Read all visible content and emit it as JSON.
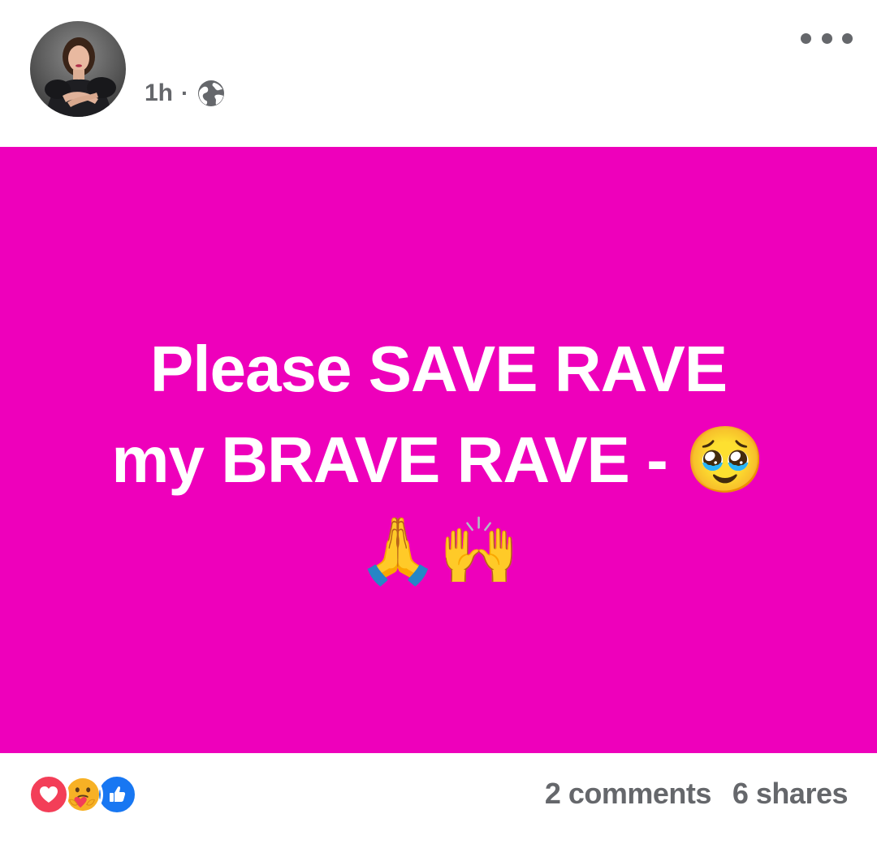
{
  "post": {
    "time": "1h",
    "separator": "·",
    "privacy_icon": "globe-icon",
    "more_icon": "more-options-icon",
    "avatar_icon": "profile-avatar",
    "background_color": "#ee00bb",
    "text_line1": "Please SAVE RAVE",
    "text_line2_prefix": "my BRAVE RAVE - ",
    "text_line2_emoji": "🥹",
    "text_line3": "🙏🙌"
  },
  "footer": {
    "reactions": [
      "heart-reaction-icon",
      "care-reaction-icon",
      "like-reaction-icon"
    ],
    "comments": "2 comments",
    "shares": "6 shares"
  }
}
